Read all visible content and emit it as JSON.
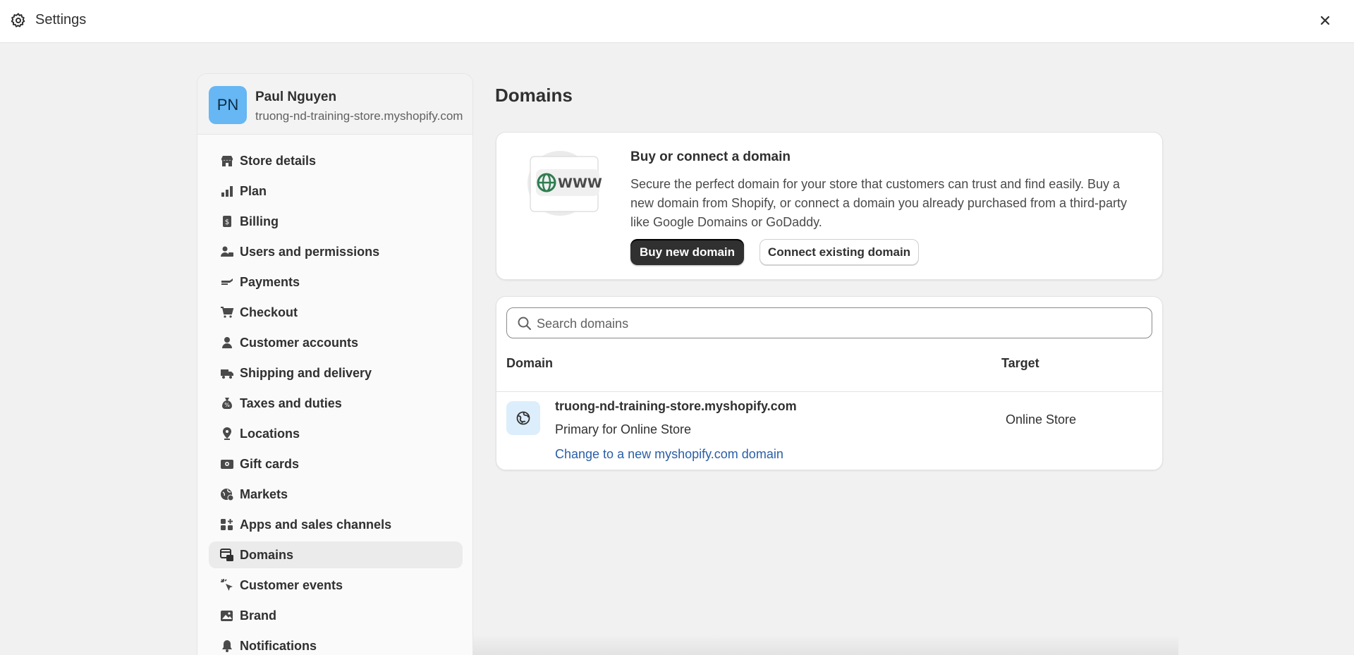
{
  "window": {
    "title": "Settings",
    "gear_icon": "gear-icon",
    "close_icon": "close-icon"
  },
  "profile": {
    "initials": "PN",
    "avatar_color": "#66b7f4",
    "name": "Paul Nguyen",
    "store": "truong-nd-training-store.myshopify.com"
  },
  "nav": {
    "items": [
      {
        "label": "Store details",
        "icon": "store-icon"
      },
      {
        "label": "Plan",
        "icon": "plan-icon"
      },
      {
        "label": "Billing",
        "icon": "billing-icon"
      },
      {
        "label": "Users and permissions",
        "icon": "users-icon"
      },
      {
        "label": "Payments",
        "icon": "payments-icon"
      },
      {
        "label": "Checkout",
        "icon": "cart-icon"
      },
      {
        "label": "Customer accounts",
        "icon": "person-icon"
      },
      {
        "label": "Shipping and delivery",
        "icon": "truck-icon"
      },
      {
        "label": "Taxes and duties",
        "icon": "tax-icon"
      },
      {
        "label": "Locations",
        "icon": "location-pin-icon"
      },
      {
        "label": "Gift cards",
        "icon": "gift-card-icon"
      },
      {
        "label": "Markets",
        "icon": "globe-market-icon"
      },
      {
        "label": "Apps and sales channels",
        "icon": "apps-icon"
      },
      {
        "label": "Domains",
        "icon": "domains-icon",
        "active": true
      },
      {
        "label": "Customer events",
        "icon": "cursor-icon"
      },
      {
        "label": "Brand",
        "icon": "brand-icon"
      },
      {
        "label": "Notifications",
        "icon": "bell-icon"
      }
    ]
  },
  "main": {
    "page_title": "Domains",
    "promo": {
      "heading": "Buy or connect a domain",
      "description": "Secure the perfect domain for your store that customers can trust and find easily. Buy a new domain from Shopify, or connect a domain you already purchased from a third-party like Google Domains or GoDaddy.",
      "illustration_text": "WWW",
      "buy_button": "Buy new domain",
      "connect_button": "Connect existing domain"
    },
    "domains": {
      "search_placeholder": "Search domains",
      "columns": {
        "domain": "Domain",
        "target": "Target"
      },
      "rows": [
        {
          "name": "truong-nd-training-store.myshopify.com",
          "subtitle": "Primary for Online Store",
          "link": "Change to a new myshopify.com domain",
          "target": "Online Store"
        }
      ]
    }
  },
  "colors": {
    "primary_button": "#303030",
    "link": "#2a5ea8",
    "domain_icon_bg": "#dceefb"
  }
}
